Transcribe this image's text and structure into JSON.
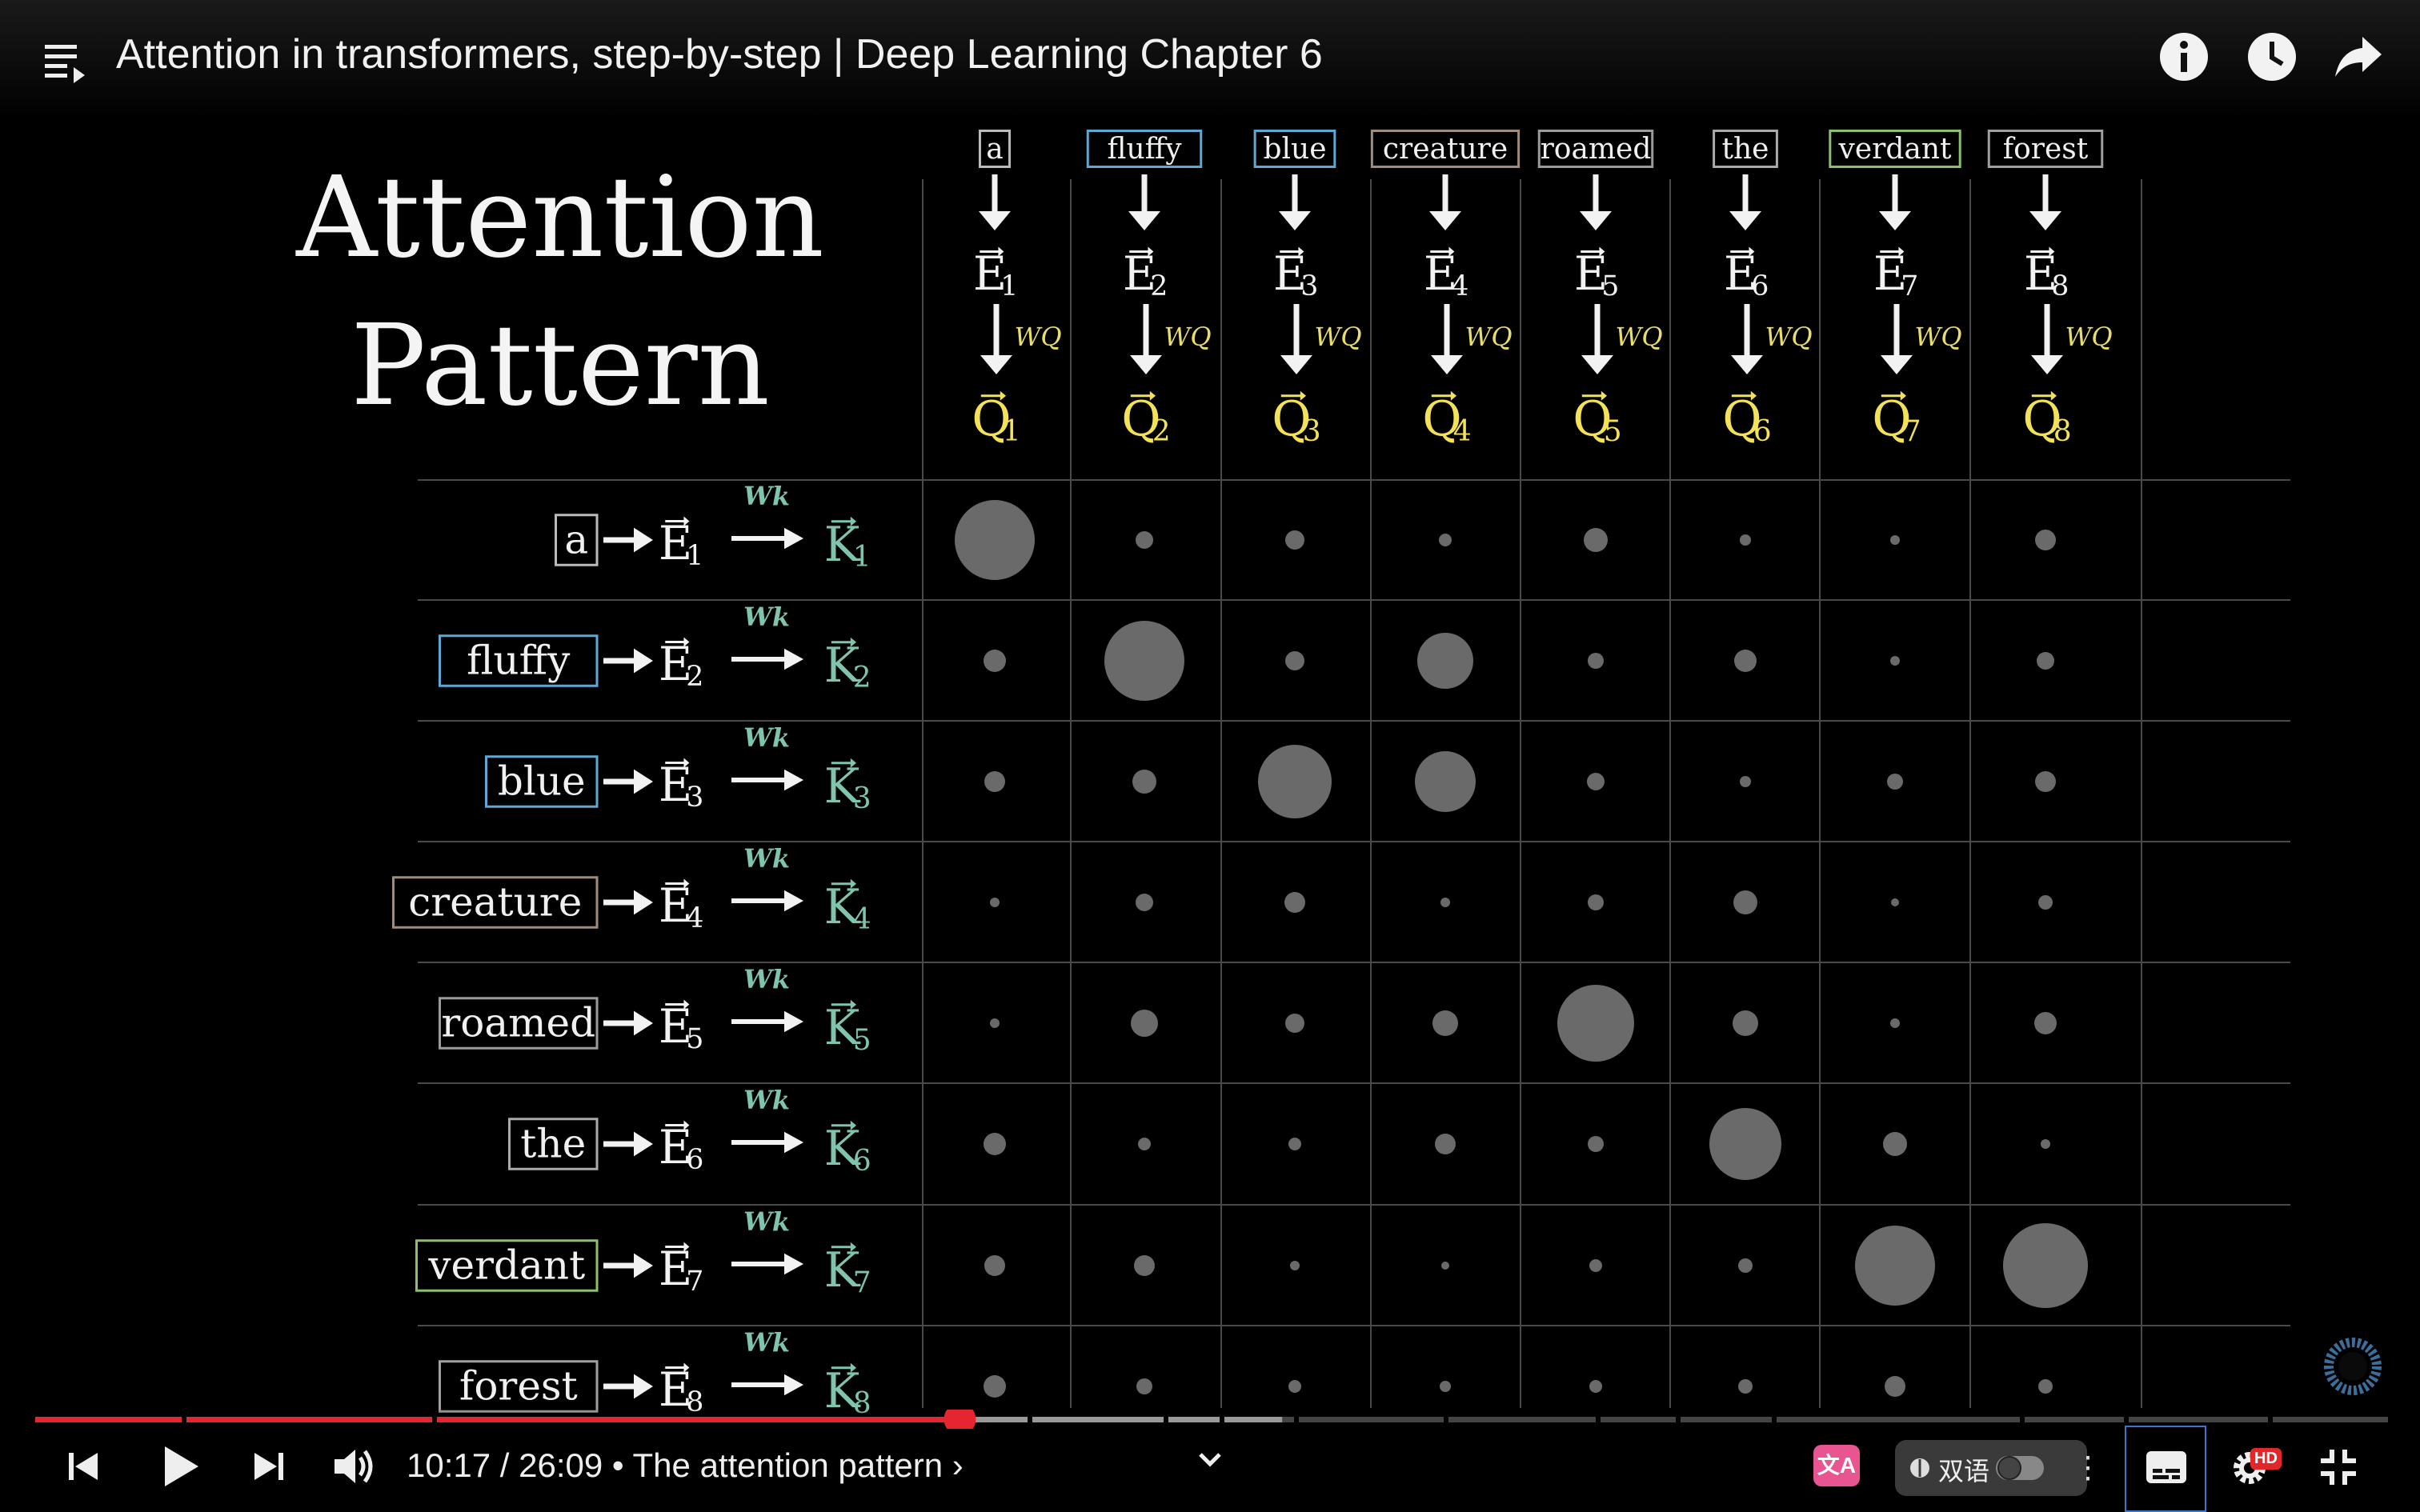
{
  "window": {
    "title": "Attention in transformers, step-by-step | Deep Learning Chapter 6"
  },
  "slide": {
    "heading_line1": "Attention",
    "heading_line2": "Pattern",
    "tokens": [
      "a",
      "fluffy",
      "blue",
      "creature",
      "roamed",
      "the",
      "verdant",
      "forest"
    ],
    "token_colors": [
      "#bbbbbb",
      "#5fa8d3",
      "#5fa8d3",
      "#a08c7c",
      "#9b9b9b",
      "#aaaaaa",
      "#8cc06c",
      "#a0a0a0"
    ],
    "embed_symbol": "E",
    "query_symbol": "Q",
    "key_symbol": "K",
    "query_matrix_label": "WQ",
    "key_matrix_label": "Wk",
    "query_color": "#f3e257",
    "key_color": "#7fc4ad",
    "weights_color": "#e9dd6b",
    "dot_color": "#6a6a6a"
  },
  "chart_data": {
    "type": "heatmap",
    "title": "Attention Pattern",
    "columns": [
      "a",
      "fluffy",
      "blue",
      "creature",
      "roamed",
      "the",
      "verdant",
      "forest"
    ],
    "rows": [
      "a",
      "fluffy",
      "blue",
      "creature",
      "roamed",
      "the",
      "verdant",
      "forest"
    ],
    "dot_sizes": [
      [
        1.0,
        0.22,
        0.24,
        0.16,
        0.3,
        0.14,
        0.12,
        0.26
      ],
      [
        0.28,
        1.0,
        0.24,
        0.7,
        0.2,
        0.28,
        0.12,
        0.22
      ],
      [
        0.26,
        0.3,
        0.92,
        0.76,
        0.22,
        0.14,
        0.2,
        0.26
      ],
      [
        0.12,
        0.22,
        0.26,
        0.12,
        0.2,
        0.3,
        0.1,
        0.18
      ],
      [
        0.12,
        0.34,
        0.24,
        0.32,
        0.96,
        0.32,
        0.12,
        0.28
      ],
      [
        0.28,
        0.16,
        0.16,
        0.26,
        0.2,
        0.9,
        0.3,
        0.12
      ],
      [
        0.26,
        0.26,
        0.12,
        0.1,
        0.16,
        0.18,
        1.0,
        1.06
      ],
      [
        0.28,
        0.2,
        0.16,
        0.14,
        0.16,
        0.18,
        0.26,
        0.18
      ]
    ]
  },
  "player": {
    "current_time": "10:17",
    "duration": "26:09",
    "chapter": "The attention pattern",
    "progress": 0.393,
    "translate_badge": "文A",
    "bilingual_label": "双语",
    "more_label": "⋮",
    "quality_badge": "HD",
    "accent": "#e52530"
  }
}
